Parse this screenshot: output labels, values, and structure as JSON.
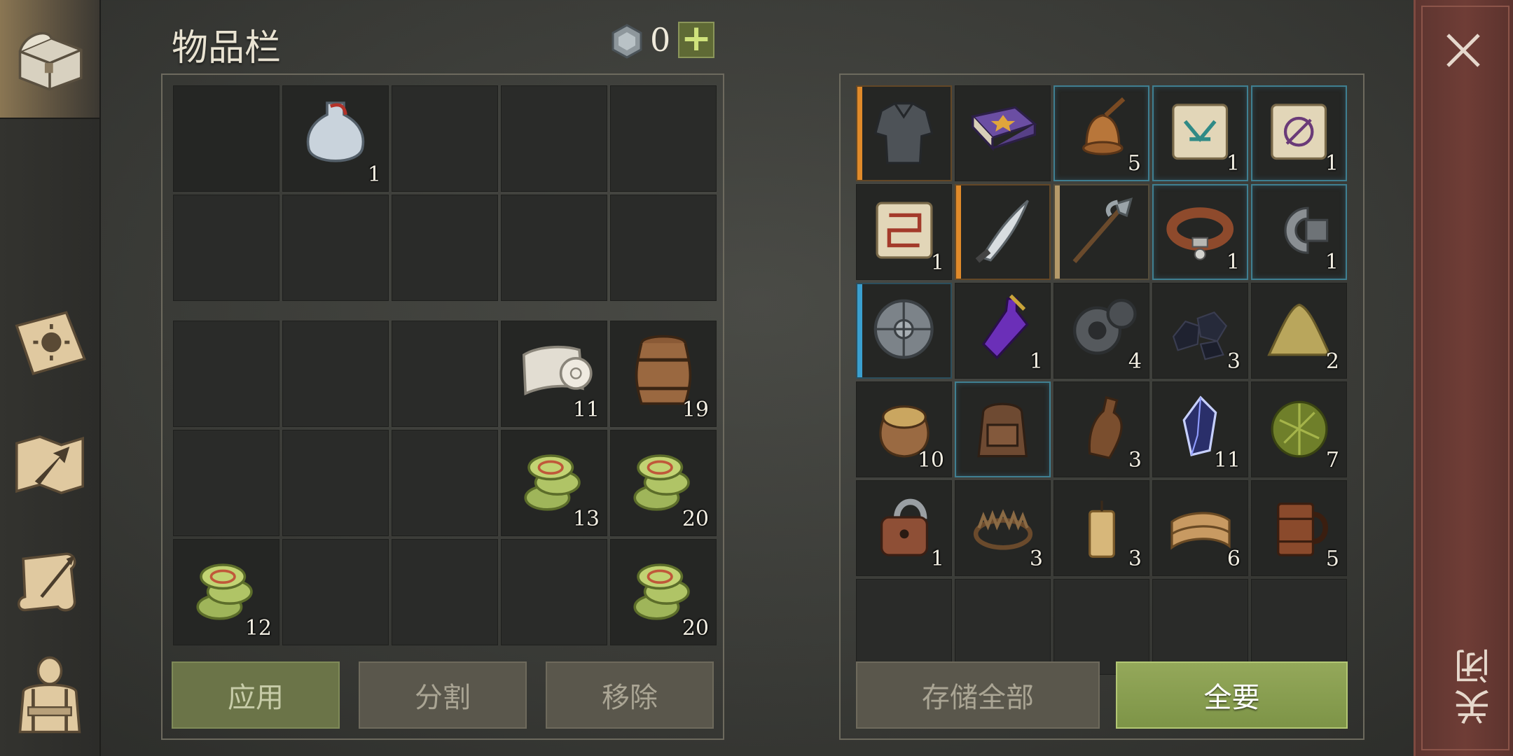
{
  "header": {
    "title": "物品栏",
    "gem_count": "0"
  },
  "left_top_grid": [
    {
      "item": "potion-flask-icon",
      "qty": ""
    },
    {
      "item": "potion-flask-icon",
      "qty": "1"
    },
    {
      "item": "",
      "qty": ""
    },
    {
      "item": "",
      "qty": ""
    },
    {
      "item": "",
      "qty": ""
    },
    {
      "item": "",
      "qty": ""
    },
    {
      "item": "",
      "qty": ""
    },
    {
      "item": "",
      "qty": ""
    },
    {
      "item": "",
      "qty": ""
    },
    {
      "item": "",
      "qty": ""
    }
  ],
  "left_bottom_grid": [
    {
      "item": "",
      "qty": ""
    },
    {
      "item": "",
      "qty": ""
    },
    {
      "item": "",
      "qty": ""
    },
    {
      "item": "cloth-roll-icon",
      "qty": "11"
    },
    {
      "item": "barrel-icon",
      "qty": "19"
    },
    {
      "item": "",
      "qty": ""
    },
    {
      "item": "",
      "qty": ""
    },
    {
      "item": "",
      "qty": ""
    },
    {
      "item": "coin-stack-icon",
      "qty": "13"
    },
    {
      "item": "coin-stack-icon",
      "qty": "20"
    },
    {
      "item": "coin-stack-icon",
      "qty": "12"
    },
    {
      "item": "",
      "qty": ""
    },
    {
      "item": "",
      "qty": ""
    },
    {
      "item": "",
      "qty": ""
    },
    {
      "item": "coin-stack-icon",
      "qty": "20"
    }
  ],
  "right_grid": [
    {
      "item": "chainmail-armor-icon",
      "qty": "",
      "rarity": "orange"
    },
    {
      "item": "purple-book-icon",
      "qty": "",
      "rarity": ""
    },
    {
      "item": "bronze-bell-icon",
      "qty": "5",
      "rarity": "blue"
    },
    {
      "item": "teal-rune-scroll-icon",
      "qty": "1",
      "rarity": "blue"
    },
    {
      "item": "purple-rune-scroll-icon",
      "qty": "1",
      "rarity": "blue"
    },
    {
      "item": "red-rune-scroll-icon",
      "qty": "1",
      "rarity": ""
    },
    {
      "item": "curved-sword-icon",
      "qty": "",
      "rarity": "orange"
    },
    {
      "item": "halberd-icon",
      "qty": "",
      "rarity": "tan"
    },
    {
      "item": "leather-collar-icon",
      "qty": "1",
      "rarity": "blue"
    },
    {
      "item": "metal-clamp-icon",
      "qty": "1",
      "rarity": "blue"
    },
    {
      "item": "round-shield-icon",
      "qty": "",
      "rarity": "lightblue"
    },
    {
      "item": "purple-potion-icon",
      "qty": "1",
      "rarity": ""
    },
    {
      "item": "gear-icon",
      "qty": "4",
      "rarity": ""
    },
    {
      "item": "coal-icon",
      "qty": "3",
      "rarity": ""
    },
    {
      "item": "sand-pile-icon",
      "qty": "2",
      "rarity": ""
    },
    {
      "item": "grain-sack-icon",
      "qty": "10",
      "rarity": ""
    },
    {
      "item": "backpack-icon",
      "qty": "",
      "rarity": "blue"
    },
    {
      "item": "clay-bottle-icon",
      "qty": "3",
      "rarity": ""
    },
    {
      "item": "dark-crystal-icon",
      "qty": "11",
      "rarity": ""
    },
    {
      "item": "herb-ball-icon",
      "qty": "7",
      "rarity": ""
    },
    {
      "item": "padlock-icon",
      "qty": "1",
      "rarity": ""
    },
    {
      "item": "bear-trap-icon",
      "qty": "3",
      "rarity": ""
    },
    {
      "item": "candle-icon",
      "qty": "3",
      "rarity": ""
    },
    {
      "item": "folded-fabric-icon",
      "qty": "6",
      "rarity": ""
    },
    {
      "item": "wooden-mug-icon",
      "qty": "5",
      "rarity": ""
    },
    {
      "item": "",
      "qty": "",
      "rarity": ""
    },
    {
      "item": "",
      "qty": "",
      "rarity": ""
    },
    {
      "item": "",
      "qty": "",
      "rarity": ""
    },
    {
      "item": "",
      "qty": "",
      "rarity": ""
    },
    {
      "item": "",
      "qty": "",
      "rarity": ""
    }
  ],
  "buttons": {
    "apply": "应用",
    "split": "分割",
    "remove": "移除",
    "store_all": "存储全部",
    "take_all": "全要"
  },
  "close_label": "关闭",
  "colors": {
    "accent_green": "#8ea653",
    "rarity_orange": "#e08a2a",
    "rarity_blue": "#3f7f91",
    "rarity_lightblue": "#3aa0d0",
    "rarity_tan": "#b59a6a",
    "close_red": "#6a3a34"
  }
}
